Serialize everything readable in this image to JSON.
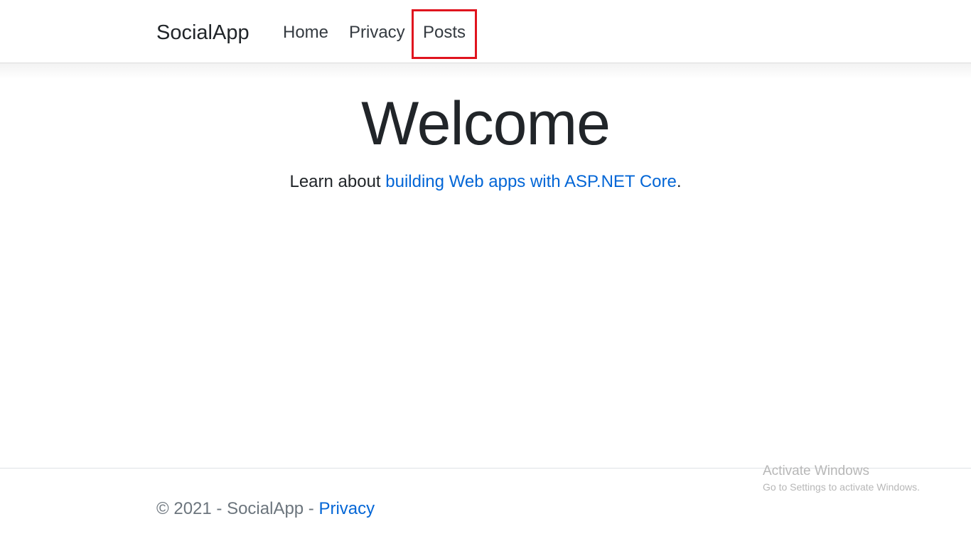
{
  "header": {
    "brand": "SocialApp",
    "nav": {
      "home": "Home",
      "privacy": "Privacy",
      "posts": "Posts"
    }
  },
  "main": {
    "heading": "Welcome",
    "lead_prefix": "Learn about ",
    "lead_link": "building Web apps with ASP.NET Core",
    "lead_suffix": "."
  },
  "footer": {
    "copyright": "© 2021 - SocialApp - ",
    "privacy_link": "Privacy"
  },
  "watermark": {
    "title": "Activate Windows",
    "subtitle": "Go to Settings to activate Windows."
  },
  "colors": {
    "link": "#0366d6",
    "highlight": "#e0141e",
    "text": "#212529",
    "muted": "#6c757d"
  }
}
